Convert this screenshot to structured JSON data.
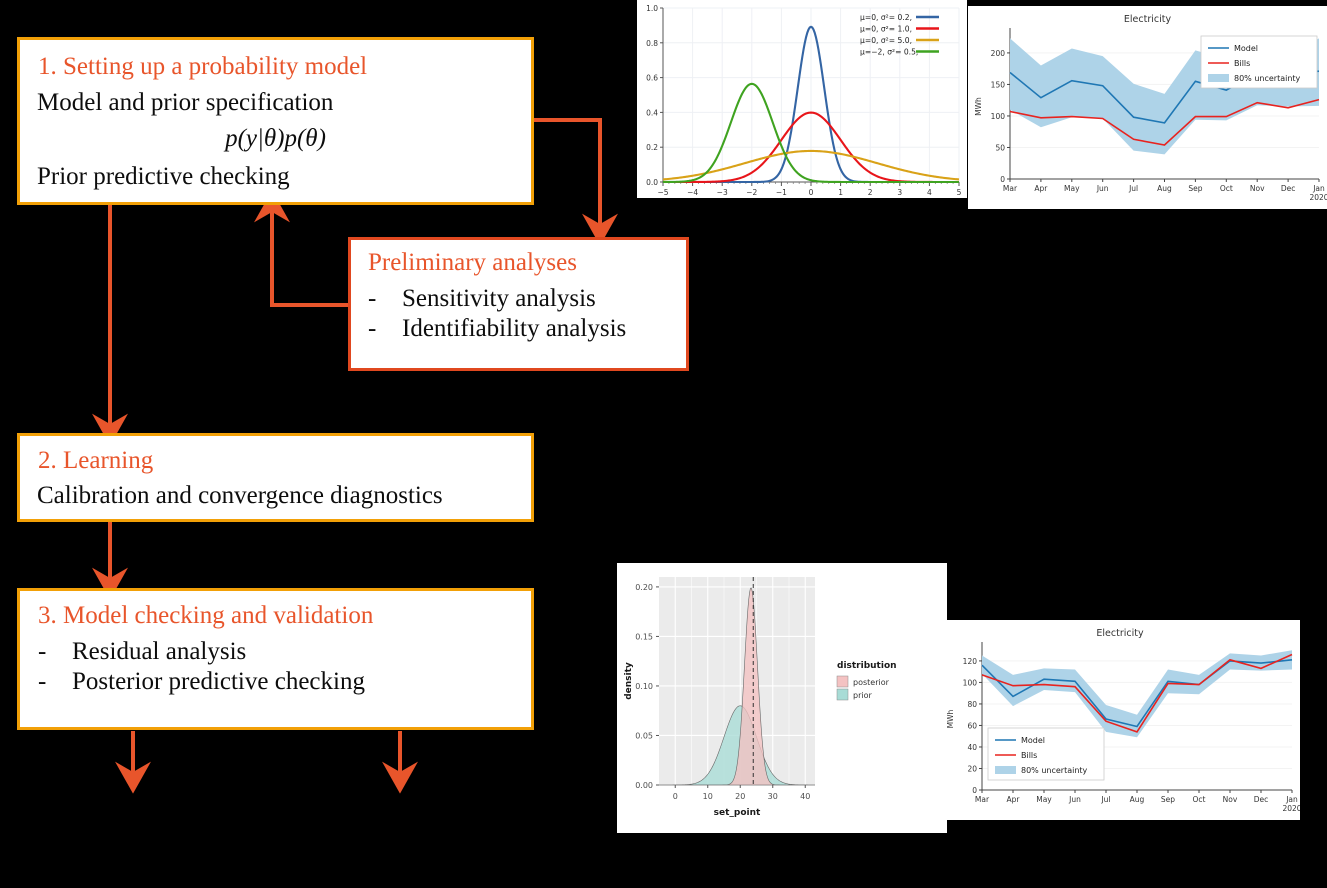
{
  "colors": {
    "accent_orange": "#E8552B",
    "box_border_amber": "#F2A007",
    "box_border_red": "#E0481F",
    "arrow": "#E8552B",
    "model_blue": "#1f77b4",
    "bills_red": "#e8231f",
    "uncertainty_blue": "#aed3e8",
    "posterior_pink": "#f4c2c2",
    "prior_teal": "#a8dcd6",
    "panel_grey": "#ebebeb"
  },
  "flow": {
    "step1": {
      "title": "1. Setting up a probability model",
      "line1": "Model and prior specification",
      "formula": "p(y|θ)p(θ)",
      "line2": "Prior predictive checking"
    },
    "preliminary": {
      "title": "Preliminary analyses",
      "bullets": [
        {
          "dash": "-",
          "text": "Sensitivity analysis"
        },
        {
          "dash": "-",
          "text": "Identifiability analysis"
        }
      ]
    },
    "step2": {
      "title": "2. Learning",
      "line1": "Calibration and convergence diagnostics"
    },
    "step3": {
      "title": "3. Model checking and validation",
      "bullets": [
        {
          "dash": "-",
          "text": "Residual analysis"
        },
        {
          "dash": "-",
          "text": "Posterior predictive checking"
        }
      ]
    }
  },
  "chart_data": [
    {
      "id": "gaussian_pdf",
      "type": "line",
      "title": "",
      "xlabel": "",
      "ylabel": "",
      "xlim": [
        -5,
        5
      ],
      "ylim": [
        0,
        1.0
      ],
      "xticks": [
        "−5",
        "−4",
        "−3",
        "−2",
        "−1",
        "0",
        "1",
        "2",
        "3",
        "4",
        "5"
      ],
      "yticks": [
        "0.0",
        "0.2",
        "0.4",
        "0.6",
        "0.8",
        "1.0"
      ],
      "grid": true,
      "legend_position": "top-right",
      "series": [
        {
          "name": "μ=0,   σ²= 0.2,",
          "mu": 0,
          "var": 0.2,
          "peak": 0.8921,
          "color": "#3465a4"
        },
        {
          "name": "μ=0,   σ²= 1.0,",
          "mu": 0,
          "var": 1.0,
          "peak": 0.3989,
          "color": "#e8151a"
        },
        {
          "name": "μ=0,   σ²= 5.0,",
          "mu": 0,
          "var": 5.0,
          "peak": 0.1784,
          "color": "#d9a218"
        },
        {
          "name": "μ=−2, σ²= 0.5,",
          "mu": -2,
          "var": 0.5,
          "peak": 0.5642,
          "color": "#3fa320"
        }
      ]
    },
    {
      "id": "electricity_top",
      "type": "line",
      "title": "Electricity",
      "xlabel": "",
      "ylabel": "MWh",
      "ylim": [
        0,
        230
      ],
      "yticks": [
        "0",
        "50",
        "100",
        "150",
        "200"
      ],
      "categories": [
        "Mar",
        "Apr",
        "May",
        "Jun",
        "Jul",
        "Aug",
        "Sep",
        "Oct",
        "Nov",
        "Dec",
        "Jan"
      ],
      "last_tick_sub": "2020",
      "grid": true,
      "legend_position": "top-right",
      "legend": [
        "Model",
        "Bills",
        "80% uncertainty"
      ],
      "series": [
        {
          "name": "Model",
          "color": "#1f77b4",
          "values": [
            169,
            129,
            156,
            148,
            98,
            89,
            155,
            141,
            168,
            167,
            171
          ]
        },
        {
          "name": "Bills",
          "color": "#e8231f",
          "values": [
            107,
            97,
            99,
            96,
            63,
            54,
            99,
            99,
            121,
            113,
            126
          ]
        },
        {
          "name": "80% uncertainty lower",
          "color": "#aed3e8",
          "values": [
            110,
            82,
            98,
            96,
            45,
            39,
            94,
            93,
            117,
            115,
            116
          ]
        },
        {
          "name": "80% uncertainty upper",
          "color": "#aed3e8",
          "values": [
            223,
            180,
            207,
            195,
            151,
            135,
            204,
            190,
            196,
            197,
            223
          ]
        }
      ]
    },
    {
      "id": "density_setpoint",
      "type": "area",
      "title": "",
      "xlabel": "set_point",
      "ylabel": "density",
      "xlim": [
        -5,
        43
      ],
      "ylim": [
        0,
        0.21
      ],
      "xticks": [
        "0",
        "10",
        "20",
        "30",
        "40"
      ],
      "yticks": [
        "0.00",
        "0.05",
        "0.10",
        "0.15",
        "0.20"
      ],
      "grid": true,
      "legend_title": "distribution",
      "legend_position": "right",
      "vline_x": 24,
      "series": [
        {
          "name": "posterior",
          "color": "#f4c2c2",
          "mean": 23.3,
          "sd": 2.0,
          "peak": 0.199
        },
        {
          "name": "prior",
          "color": "#a8dcd6",
          "mean": 20.0,
          "sd": 5.0,
          "peak": 0.08
        }
      ]
    },
    {
      "id": "electricity_bottom",
      "type": "line",
      "title": "Electricity",
      "xlabel": "",
      "ylabel": "MWh",
      "ylim": [
        0,
        132
      ],
      "yticks": [
        "0",
        "20",
        "40",
        "60",
        "80",
        "100",
        "120"
      ],
      "categories": [
        "Mar",
        "Apr",
        "May",
        "Jun",
        "Jul",
        "Aug",
        "Sep",
        "Oct",
        "Nov",
        "Dec",
        "Jan"
      ],
      "last_tick_sub": "2020",
      "grid": true,
      "legend_position": "bottom-left",
      "legend": [
        "Model",
        "Bills",
        "80% uncertainty"
      ],
      "series": [
        {
          "name": "Model",
          "color": "#1f77b4",
          "values": [
            116,
            87,
            103,
            101,
            66,
            59,
            101,
            98,
            120,
            118,
            121
          ]
        },
        {
          "name": "Bills",
          "color": "#e8231f",
          "values": [
            107,
            97,
            98,
            96,
            64,
            54,
            99,
            98,
            121,
            113,
            126
          ]
        },
        {
          "name": "80% uncertainty lower",
          "color": "#aed3e8",
          "values": [
            108,
            78,
            93,
            91,
            54,
            49,
            90,
            89,
            112,
            111,
            112
          ]
        },
        {
          "name": "80% uncertainty upper",
          "color": "#aed3e8",
          "values": [
            125,
            107,
            113,
            112,
            79,
            70,
            112,
            107,
            127,
            125,
            130
          ]
        }
      ]
    }
  ]
}
